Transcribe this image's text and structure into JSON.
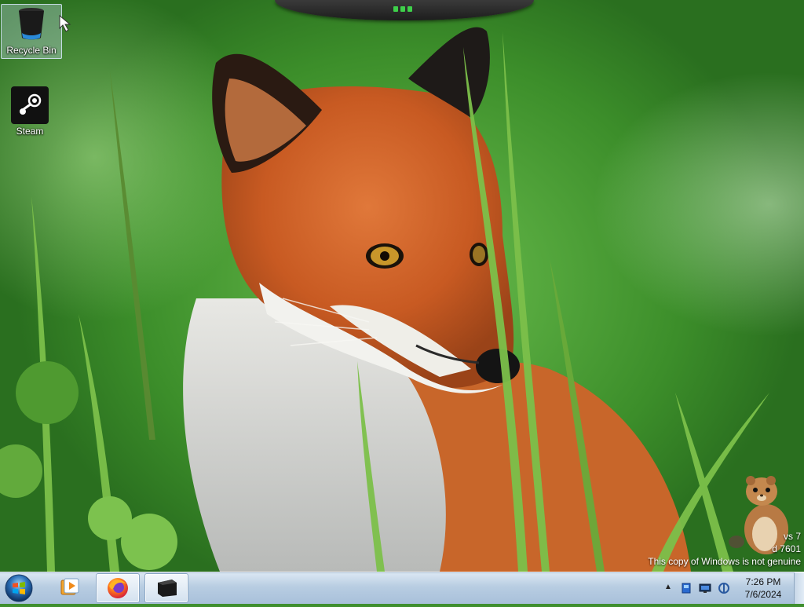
{
  "desktop": {
    "icons": [
      {
        "label": "Recycle Bin",
        "icon": "recycle-bin-icon"
      },
      {
        "label": "Steam",
        "icon": "steam-icon"
      }
    ],
    "wallpaper": "fox-in-grass"
  },
  "watermark": {
    "line1": "vs 7",
    "line2": "d 7601",
    "line3": "This copy of Windows is not genuine"
  },
  "taskbar": {
    "start": "windows-orb-icon",
    "pinned": [
      {
        "name": "media-player-icon"
      },
      {
        "name": "firefox-icon"
      },
      {
        "name": "window-app-icon"
      }
    ]
  },
  "tray": {
    "chevron": "▲",
    "time": "7:26 PM",
    "date": "7/6/2024"
  },
  "colors": {
    "taskbar": "#b8cde2",
    "top_bar": "#1d1d1d",
    "indicator": "#3ed04a"
  }
}
